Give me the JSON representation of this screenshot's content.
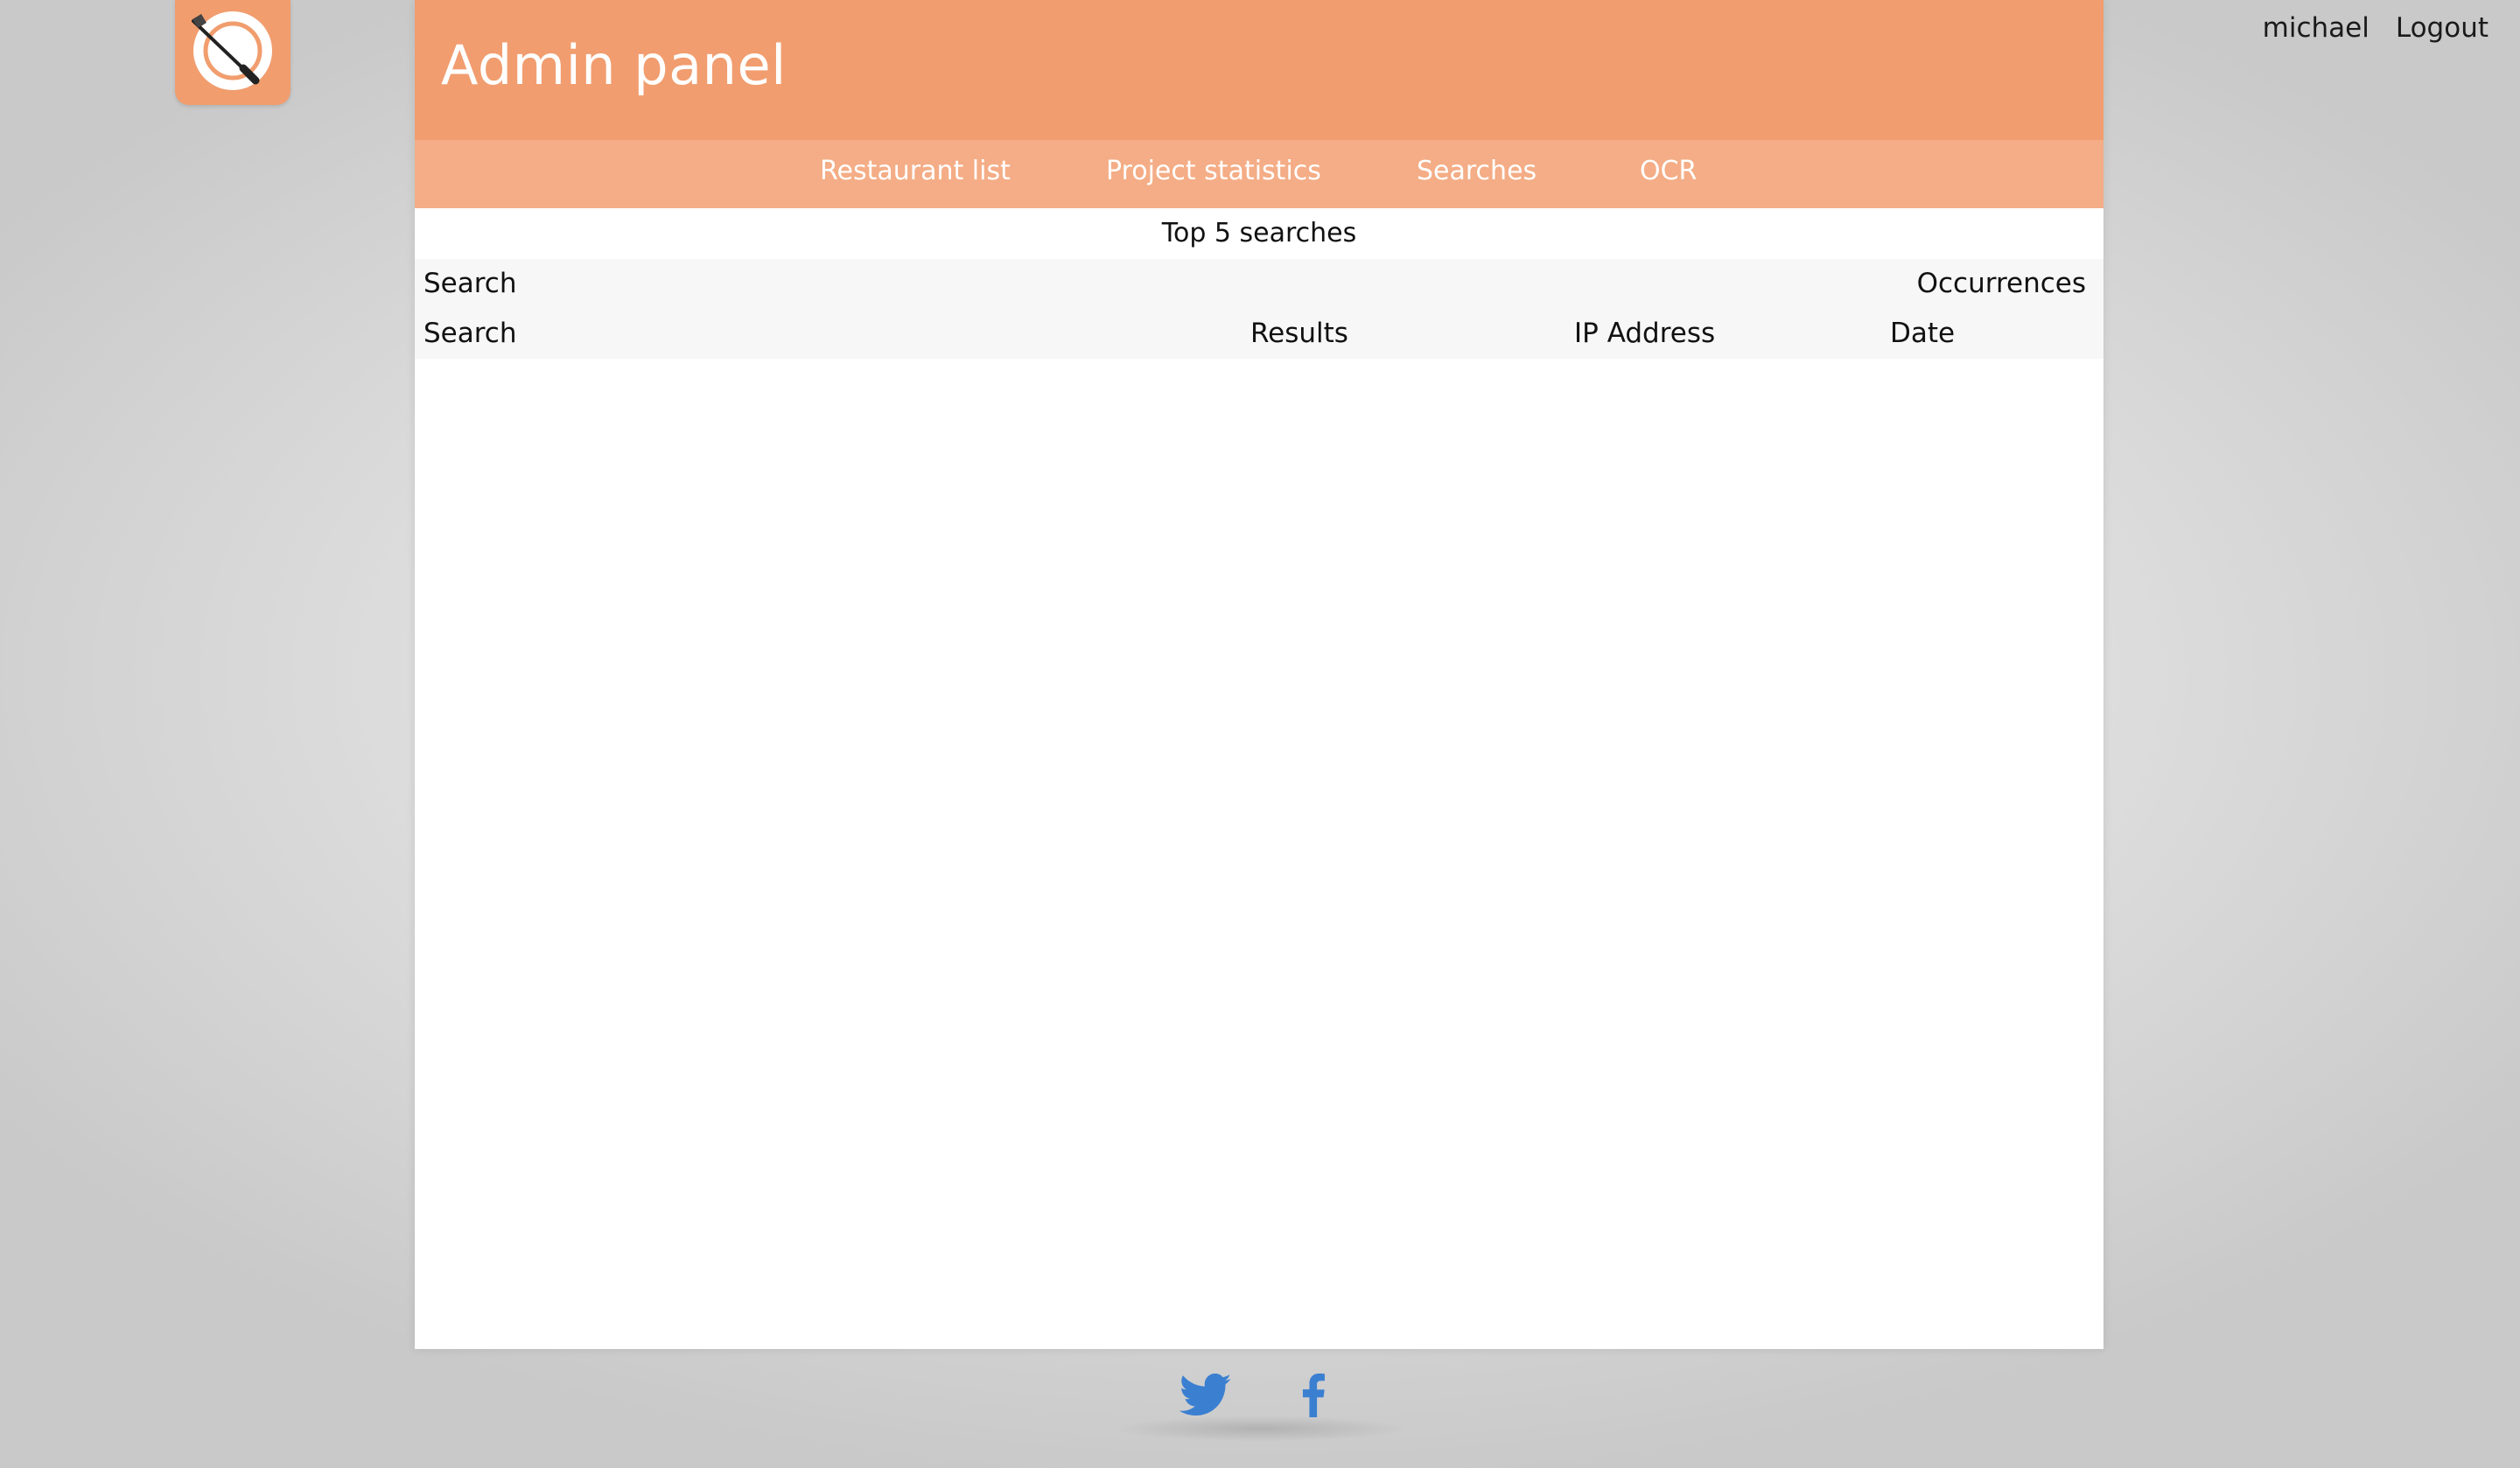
{
  "header": {
    "title": "Admin panel"
  },
  "user": {
    "name": "michael",
    "logout_label": "Logout"
  },
  "nav": {
    "items": [
      {
        "label": "Restaurant list"
      },
      {
        "label": "Project statistics"
      },
      {
        "label": "Searches"
      },
      {
        "label": "OCR"
      }
    ]
  },
  "top_searches": {
    "title": "Top 5 searches",
    "columns": [
      "Search",
      "Occurrences"
    ],
    "rows": []
  },
  "searches_table": {
    "columns": [
      "Search",
      "Results",
      "IP Address",
      "Date"
    ],
    "rows": []
  },
  "footer": {
    "icons": [
      "twitter-icon",
      "facebook-icon"
    ]
  },
  "colors": {
    "header_accent": "#f19d6f",
    "nav_accent": "#f4ad86",
    "social_blue": "#3b7fd1"
  }
}
